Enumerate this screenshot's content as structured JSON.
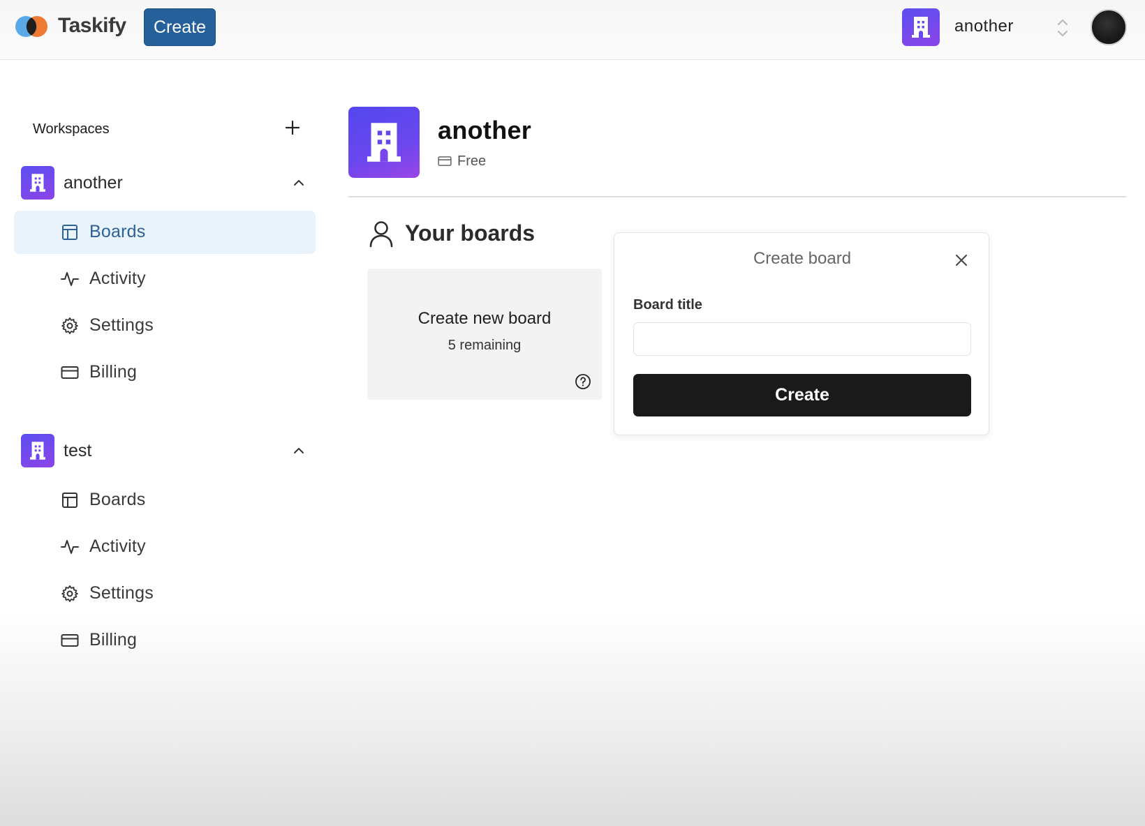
{
  "navbar": {
    "brand": "Taskify",
    "create_label": "Create",
    "org_switcher_name": "another"
  },
  "sidebar": {
    "heading": "Workspaces",
    "workspaces": [
      {
        "name": "another",
        "expanded": true,
        "items": [
          {
            "label": "Boards",
            "icon": "layout-icon",
            "active": true
          },
          {
            "label": "Activity",
            "icon": "activity-icon",
            "active": false
          },
          {
            "label": "Settings",
            "icon": "gear-icon",
            "active": false
          },
          {
            "label": "Billing",
            "icon": "credit-card-icon",
            "active": false
          }
        ]
      },
      {
        "name": "test",
        "expanded": true,
        "items": [
          {
            "label": "Boards",
            "icon": "layout-icon",
            "active": false
          },
          {
            "label": "Activity",
            "icon": "activity-icon",
            "active": false
          },
          {
            "label": "Settings",
            "icon": "gear-icon",
            "active": false
          },
          {
            "label": "Billing",
            "icon": "credit-card-icon",
            "active": false
          }
        ]
      }
    ]
  },
  "main": {
    "title": "another",
    "plan": "Free",
    "boards_heading": "Your boards",
    "new_board_card": {
      "title": "Create new board",
      "remaining": "5 remaining"
    }
  },
  "popover": {
    "title": "Create board",
    "field_label": "Board title",
    "input_value": "",
    "submit_label": "Create"
  },
  "colors": {
    "brand_blue": "#26609a",
    "org_purple": "#6b47ee",
    "active_nav_bg": "#e8f3fb",
    "active_nav_text": "#2e6196",
    "submit_bg": "#1a1a1a"
  }
}
